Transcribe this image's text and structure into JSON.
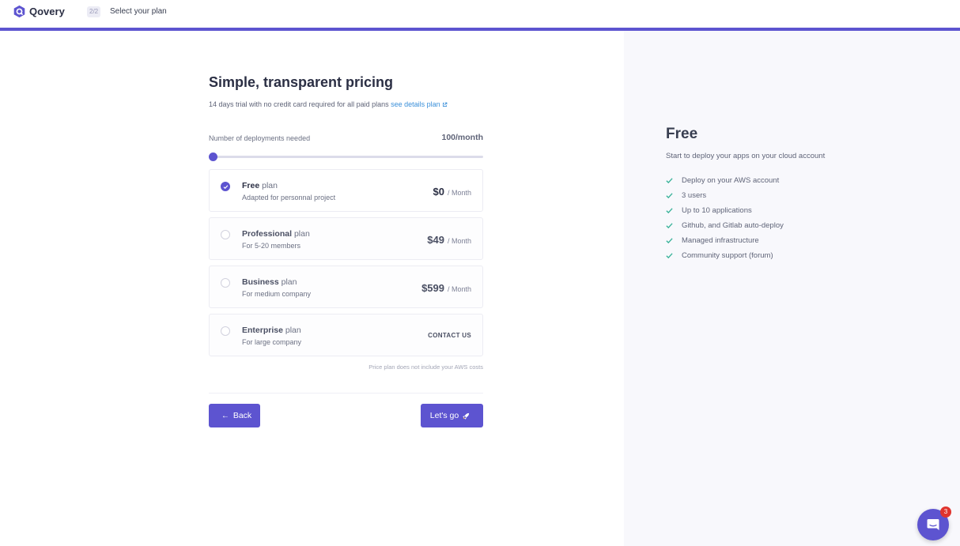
{
  "header": {
    "brand": "Qovery",
    "step": "2/2",
    "title": "Select your plan"
  },
  "main": {
    "title": "Simple, transparent pricing",
    "subtitle": "14 days trial with no credit card required for all paid plans",
    "details_link": "see details plan",
    "slider_label": "Number of deployments needed",
    "slider_value": "100/month",
    "slider_level": 0,
    "plans": [
      {
        "name": "Free",
        "suffix": "plan",
        "desc": "Adapted for personnal project",
        "price": "$0",
        "period": "/ Month",
        "selected": true
      },
      {
        "name": "Professional",
        "suffix": "plan",
        "desc": "For 5-20 members",
        "price": "$49",
        "period": "/ Month",
        "selected": false
      },
      {
        "name": "Business",
        "suffix": "plan",
        "desc": "For medium company",
        "price": "$599",
        "period": "/ Month",
        "selected": false
      },
      {
        "name": "Enterprise",
        "suffix": "plan",
        "desc": "For large company",
        "contact": "CONTACT US",
        "selected": false
      }
    ],
    "note": "Price plan does not include your AWS costs",
    "back_label": "Back",
    "go_label": "Let's go"
  },
  "summary": {
    "title": "Free",
    "subtitle": "Start to deploy your apps on your cloud account",
    "features": [
      "Deploy on your AWS account",
      "3 users",
      "Up to 10 applications",
      "Github, and Gitlab auto-deploy",
      "Managed infrastructure",
      "Community support (forum)"
    ]
  },
  "chat": {
    "badge": "3"
  },
  "colors": {
    "accent": "#5d54d0",
    "link": "#3a8fd9",
    "check": "#3ab39a",
    "badge": "#e0342e"
  },
  "icons": {
    "logo": "qovery-logo-icon",
    "external": "external-link-icon",
    "check": "check-icon",
    "back": "arrow-left-icon",
    "go": "rocket-icon",
    "chat": "chat-icon"
  }
}
